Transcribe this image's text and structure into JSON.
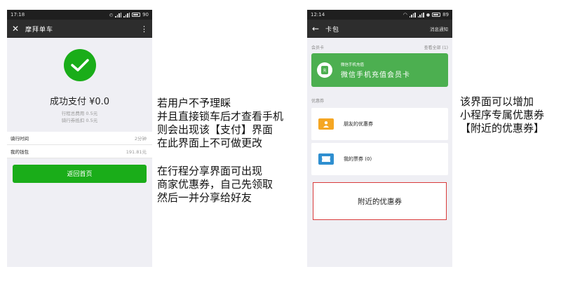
{
  "left_phone": {
    "status": {
      "time": "17:18",
      "battery": "90"
    },
    "nav": {
      "title": "摩拜单车"
    },
    "payment": {
      "title": "成功支付 ¥0.0",
      "total_fare": "行程总费用 0.5元",
      "coupon_deduct": "骑行券抵扣 0.5元"
    },
    "rows": [
      {
        "label": "骑行时间",
        "value": "2分钟"
      },
      {
        "label": "我的钱包",
        "value": "191.81元"
      }
    ],
    "home_button": "返回首页"
  },
  "notes": {
    "left": [
      "若用户不予理睬",
      "并且直接锁车后才查看手机",
      "则会出现该【支付】界面",
      "在此界面上不可做更改"
    ],
    "middle": [
      "在行程分享界面可出现",
      "商家优惠券，自己先领取",
      "然后一并分享给好友"
    ],
    "right": [
      "该界面可以增加",
      "小程序专属优惠券",
      "【附近的优惠券】"
    ]
  },
  "right_phone": {
    "status": {
      "time": "12:14",
      "battery": "89"
    },
    "nav": {
      "title": "卡包",
      "right_link": "消息通知"
    },
    "member_section": {
      "label": "会员卡",
      "link": "查看全部 (1)"
    },
    "member_card": {
      "logo_text": "充",
      "small": "微信手机充值",
      "name": "微信手机充值会员卡"
    },
    "coupon_section": {
      "label": "优惠券"
    },
    "coupons": [
      {
        "name": "朋友的优惠券",
        "icon": "friend-icon",
        "color": "#f5a623"
      },
      {
        "name": "我的票券 (0)",
        "icon": "ticket-icon",
        "color": "#2f8fd0"
      }
    ],
    "nearby_coupon": "附近的优惠券"
  }
}
